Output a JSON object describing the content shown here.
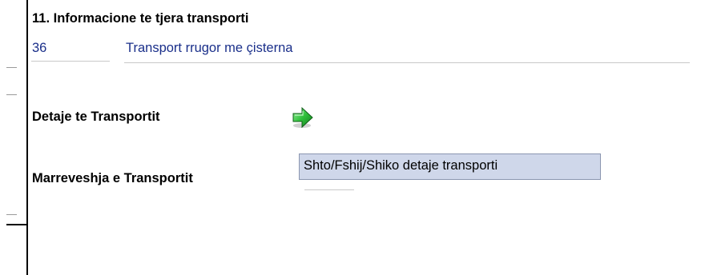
{
  "section": {
    "title": "11. Informacione te tjera transporti"
  },
  "transport": {
    "code": "36",
    "description": "Transport rrugor me çisterna"
  },
  "labels": {
    "details": "Detaje te Transportit",
    "agreement": "Marreveshja e Transportit"
  },
  "details_button": {
    "icon": "green-arrow-icon",
    "tooltip": "Shto/Fshij/Shiko detaje transporti"
  },
  "colors": {
    "value_text": "#1a2f8a",
    "tooltip_bg": "#cfd7ea",
    "arrow_green": "#2fbf3a"
  }
}
